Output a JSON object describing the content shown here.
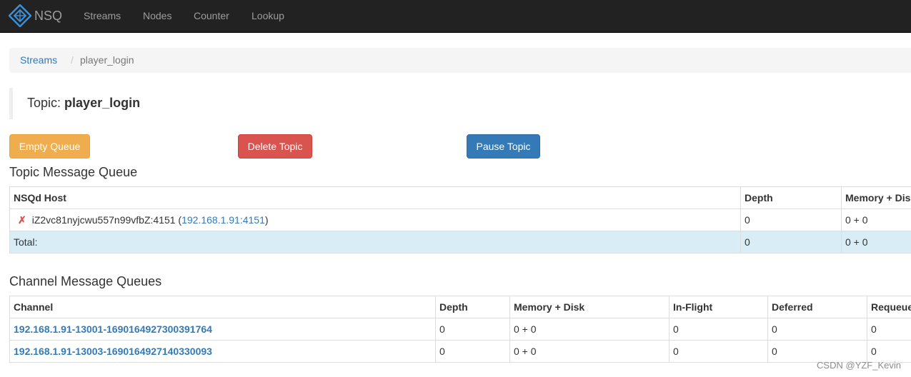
{
  "navbar": {
    "brand": "NSQ",
    "items": [
      "Streams",
      "Nodes",
      "Counter",
      "Lookup"
    ]
  },
  "breadcrumb": {
    "link": "Streams",
    "separator": "/",
    "active": "player_login"
  },
  "topic": {
    "prefix": "Topic:",
    "name": "player_login"
  },
  "buttons": {
    "empty_queue": "Empty Queue",
    "delete_topic": "Delete Topic",
    "pause_topic": "Pause Topic"
  },
  "topic_queue": {
    "title": "Topic Message Queue",
    "headers": [
      "NSQd Host",
      "Depth",
      "Memory + Dis"
    ],
    "host_row": {
      "status_icon": "✗",
      "host": "iZ2vc81nyjcwu557n99vfbZ:4151",
      "address": "192.168.1.91:4151",
      "depth": "0",
      "memory_disk": "0 + 0"
    },
    "total_row": {
      "label": "Total:",
      "depth": "0",
      "memory_disk": "0 + 0"
    }
  },
  "channel_queues": {
    "title": "Channel Message Queues",
    "headers": [
      "Channel",
      "Depth",
      "Memory + Disk",
      "In-Flight",
      "Deferred",
      "Requeue"
    ],
    "rows": [
      [
        "192.168.1.91-13001-1690164927300391764",
        "0",
        "0 + 0",
        "0",
        "0",
        "0"
      ],
      [
        "192.168.1.91-13003-1690164927140330093",
        "0",
        "0 + 0",
        "0",
        "0",
        "0"
      ]
    ]
  },
  "watermark": "CSDN @YZF_Kevin",
  "colors": {
    "navbar_bg": "#222222",
    "link": "#337ab7",
    "warning": "#f0ad4e",
    "danger": "#d9534f",
    "primary": "#337ab7",
    "info_row": "#d9edf7"
  }
}
